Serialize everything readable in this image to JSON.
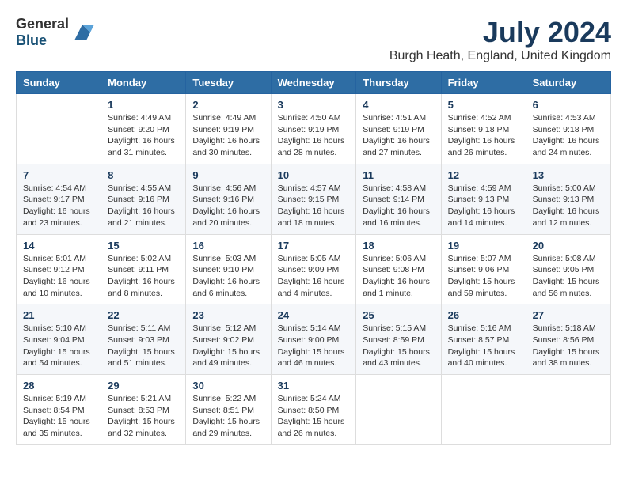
{
  "header": {
    "logo_general": "General",
    "logo_blue": "Blue",
    "month_title": "July 2024",
    "location": "Burgh Heath, England, United Kingdom"
  },
  "calendar": {
    "days_of_week": [
      "Sunday",
      "Monday",
      "Tuesday",
      "Wednesday",
      "Thursday",
      "Friday",
      "Saturday"
    ],
    "weeks": [
      [
        {
          "day": "",
          "info": ""
        },
        {
          "day": "1",
          "info": "Sunrise: 4:49 AM\nSunset: 9:20 PM\nDaylight: 16 hours\nand 31 minutes."
        },
        {
          "day": "2",
          "info": "Sunrise: 4:49 AM\nSunset: 9:19 PM\nDaylight: 16 hours\nand 30 minutes."
        },
        {
          "day": "3",
          "info": "Sunrise: 4:50 AM\nSunset: 9:19 PM\nDaylight: 16 hours\nand 28 minutes."
        },
        {
          "day": "4",
          "info": "Sunrise: 4:51 AM\nSunset: 9:19 PM\nDaylight: 16 hours\nand 27 minutes."
        },
        {
          "day": "5",
          "info": "Sunrise: 4:52 AM\nSunset: 9:18 PM\nDaylight: 16 hours\nand 26 minutes."
        },
        {
          "day": "6",
          "info": "Sunrise: 4:53 AM\nSunset: 9:18 PM\nDaylight: 16 hours\nand 24 minutes."
        }
      ],
      [
        {
          "day": "7",
          "info": "Sunrise: 4:54 AM\nSunset: 9:17 PM\nDaylight: 16 hours\nand 23 minutes."
        },
        {
          "day": "8",
          "info": "Sunrise: 4:55 AM\nSunset: 9:16 PM\nDaylight: 16 hours\nand 21 minutes."
        },
        {
          "day": "9",
          "info": "Sunrise: 4:56 AM\nSunset: 9:16 PM\nDaylight: 16 hours\nand 20 minutes."
        },
        {
          "day": "10",
          "info": "Sunrise: 4:57 AM\nSunset: 9:15 PM\nDaylight: 16 hours\nand 18 minutes."
        },
        {
          "day": "11",
          "info": "Sunrise: 4:58 AM\nSunset: 9:14 PM\nDaylight: 16 hours\nand 16 minutes."
        },
        {
          "day": "12",
          "info": "Sunrise: 4:59 AM\nSunset: 9:13 PM\nDaylight: 16 hours\nand 14 minutes."
        },
        {
          "day": "13",
          "info": "Sunrise: 5:00 AM\nSunset: 9:13 PM\nDaylight: 16 hours\nand 12 minutes."
        }
      ],
      [
        {
          "day": "14",
          "info": "Sunrise: 5:01 AM\nSunset: 9:12 PM\nDaylight: 16 hours\nand 10 minutes."
        },
        {
          "day": "15",
          "info": "Sunrise: 5:02 AM\nSunset: 9:11 PM\nDaylight: 16 hours\nand 8 minutes."
        },
        {
          "day": "16",
          "info": "Sunrise: 5:03 AM\nSunset: 9:10 PM\nDaylight: 16 hours\nand 6 minutes."
        },
        {
          "day": "17",
          "info": "Sunrise: 5:05 AM\nSunset: 9:09 PM\nDaylight: 16 hours\nand 4 minutes."
        },
        {
          "day": "18",
          "info": "Sunrise: 5:06 AM\nSunset: 9:08 PM\nDaylight: 16 hours\nand 1 minute."
        },
        {
          "day": "19",
          "info": "Sunrise: 5:07 AM\nSunset: 9:06 PM\nDaylight: 15 hours\nand 59 minutes."
        },
        {
          "day": "20",
          "info": "Sunrise: 5:08 AM\nSunset: 9:05 PM\nDaylight: 15 hours\nand 56 minutes."
        }
      ],
      [
        {
          "day": "21",
          "info": "Sunrise: 5:10 AM\nSunset: 9:04 PM\nDaylight: 15 hours\nand 54 minutes."
        },
        {
          "day": "22",
          "info": "Sunrise: 5:11 AM\nSunset: 9:03 PM\nDaylight: 15 hours\nand 51 minutes."
        },
        {
          "day": "23",
          "info": "Sunrise: 5:12 AM\nSunset: 9:02 PM\nDaylight: 15 hours\nand 49 minutes."
        },
        {
          "day": "24",
          "info": "Sunrise: 5:14 AM\nSunset: 9:00 PM\nDaylight: 15 hours\nand 46 minutes."
        },
        {
          "day": "25",
          "info": "Sunrise: 5:15 AM\nSunset: 8:59 PM\nDaylight: 15 hours\nand 43 minutes."
        },
        {
          "day": "26",
          "info": "Sunrise: 5:16 AM\nSunset: 8:57 PM\nDaylight: 15 hours\nand 40 minutes."
        },
        {
          "day": "27",
          "info": "Sunrise: 5:18 AM\nSunset: 8:56 PM\nDaylight: 15 hours\nand 38 minutes."
        }
      ],
      [
        {
          "day": "28",
          "info": "Sunrise: 5:19 AM\nSunset: 8:54 PM\nDaylight: 15 hours\nand 35 minutes."
        },
        {
          "day": "29",
          "info": "Sunrise: 5:21 AM\nSunset: 8:53 PM\nDaylight: 15 hours\nand 32 minutes."
        },
        {
          "day": "30",
          "info": "Sunrise: 5:22 AM\nSunset: 8:51 PM\nDaylight: 15 hours\nand 29 minutes."
        },
        {
          "day": "31",
          "info": "Sunrise: 5:24 AM\nSunset: 8:50 PM\nDaylight: 15 hours\nand 26 minutes."
        },
        {
          "day": "",
          "info": ""
        },
        {
          "day": "",
          "info": ""
        },
        {
          "day": "",
          "info": ""
        }
      ]
    ]
  }
}
